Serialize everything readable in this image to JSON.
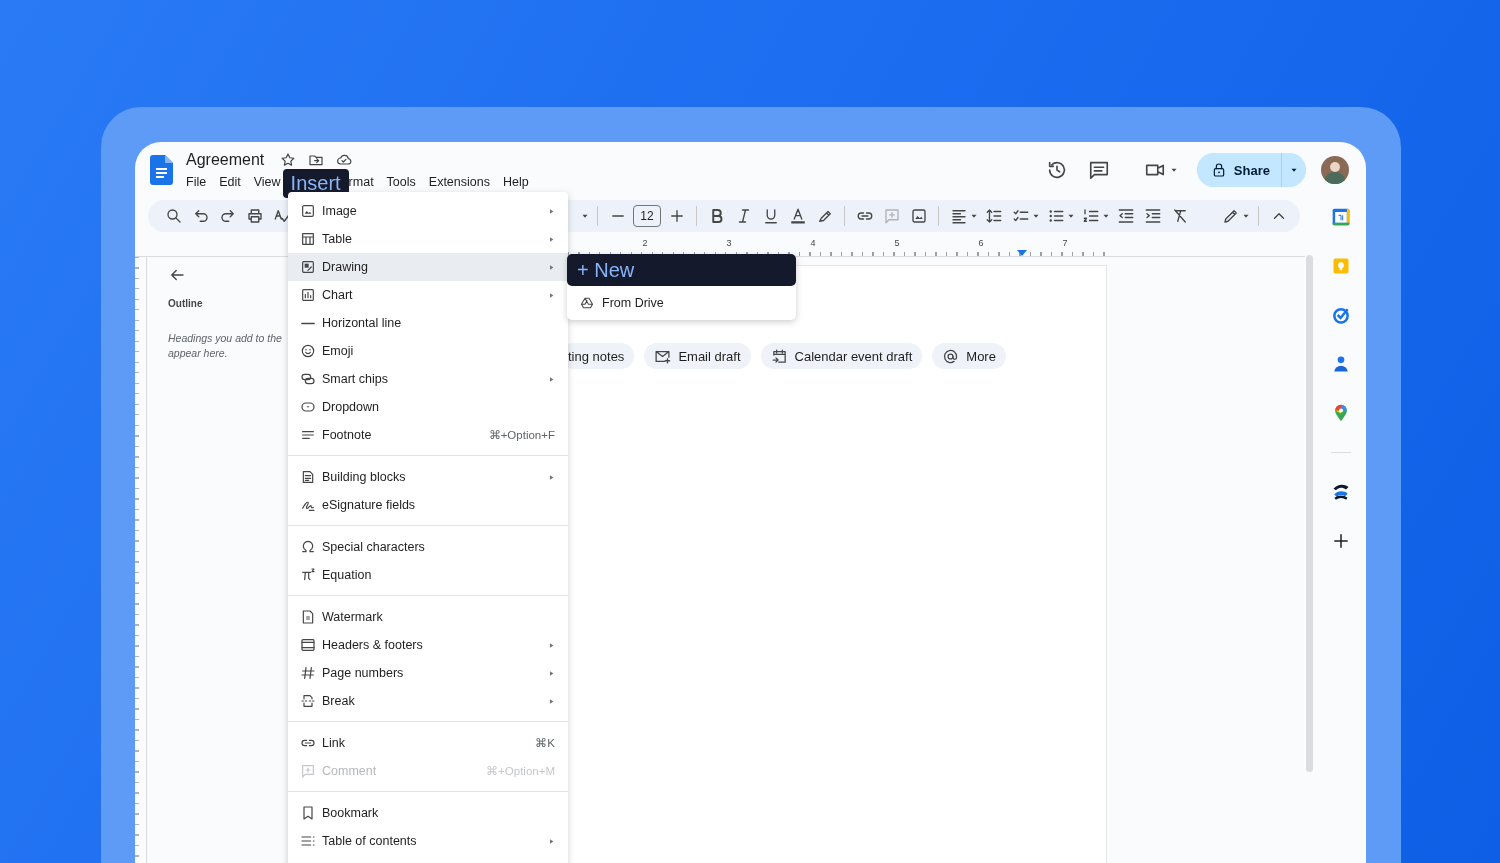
{
  "app_header": {
    "title": "Agreement",
    "menu": [
      {
        "label": "File",
        "selected": false
      },
      {
        "label": "Edit",
        "selected": false
      },
      {
        "label": "View",
        "selected": false
      },
      {
        "label": "Insert",
        "selected": true
      },
      {
        "label": "rmat",
        "selected": false
      },
      {
        "label": "Tools",
        "selected": false
      },
      {
        "label": "Extensions",
        "selected": false
      },
      {
        "label": "Help",
        "selected": false
      }
    ]
  },
  "share_button": {
    "label": "Share"
  },
  "toolbar": {
    "font_size": "12"
  },
  "ruler": {
    "numbers": [
      "2",
      "3",
      "4",
      "5",
      "6",
      "7"
    ]
  },
  "outline": {
    "title": "Outline",
    "hint": "Headings you add to the\nappear here."
  },
  "smart_chips": [
    {
      "label": "ting notes"
    },
    {
      "label": "Email draft"
    },
    {
      "label": "Calendar event draft"
    },
    {
      "label": "More"
    }
  ],
  "insert_menu": {
    "groups": [
      [
        {
          "label": "Image",
          "submenu": true,
          "selected": false,
          "disabled": false
        },
        {
          "label": "Table",
          "submenu": true,
          "selected": false,
          "disabled": false
        },
        {
          "label": "Drawing",
          "submenu": true,
          "selected": true,
          "disabled": false
        },
        {
          "label": "Chart",
          "submenu": true,
          "selected": false,
          "disabled": false
        },
        {
          "label": "Horizontal line",
          "submenu": false,
          "selected": false,
          "disabled": false
        },
        {
          "label": "Emoji",
          "submenu": false,
          "selected": false,
          "disabled": false
        },
        {
          "label": "Smart chips",
          "submenu": true,
          "selected": false,
          "disabled": false
        },
        {
          "label": "Dropdown",
          "submenu": false,
          "selected": false,
          "disabled": false
        },
        {
          "label": "Footnote",
          "shortcut": "⌘+Option+F",
          "submenu": false,
          "selected": false,
          "disabled": false
        }
      ],
      [
        {
          "label": "Building blocks",
          "submenu": true,
          "selected": false,
          "disabled": false
        },
        {
          "label": "eSignature fields",
          "submenu": false,
          "selected": false,
          "disabled": false
        }
      ],
      [
        {
          "label": "Special characters",
          "submenu": false,
          "selected": false,
          "disabled": false
        },
        {
          "label": "Equation",
          "submenu": false,
          "selected": false,
          "disabled": false
        }
      ],
      [
        {
          "label": "Watermark",
          "submenu": false,
          "selected": false,
          "disabled": false
        },
        {
          "label": "Headers & footers",
          "submenu": true,
          "selected": false,
          "disabled": false
        },
        {
          "label": "Page numbers",
          "submenu": true,
          "selected": false,
          "disabled": false
        },
        {
          "label": "Break",
          "submenu": true,
          "selected": false,
          "disabled": false
        }
      ],
      [
        {
          "label": "Link",
          "shortcut": "⌘K",
          "submenu": false,
          "selected": false,
          "disabled": false
        },
        {
          "label": "Comment",
          "shortcut": "⌘+Option+M",
          "submenu": false,
          "selected": false,
          "disabled": true
        }
      ],
      [
        {
          "label": "Bookmark",
          "submenu": false,
          "selected": false,
          "disabled": false
        },
        {
          "label": "Table of contents",
          "submenu": true,
          "selected": false,
          "disabled": false
        }
      ]
    ]
  },
  "drawing_submenu": {
    "items": [
      {
        "label": "+ New",
        "selected": true
      },
      {
        "label": "From Drive",
        "selected": false
      }
    ]
  }
}
